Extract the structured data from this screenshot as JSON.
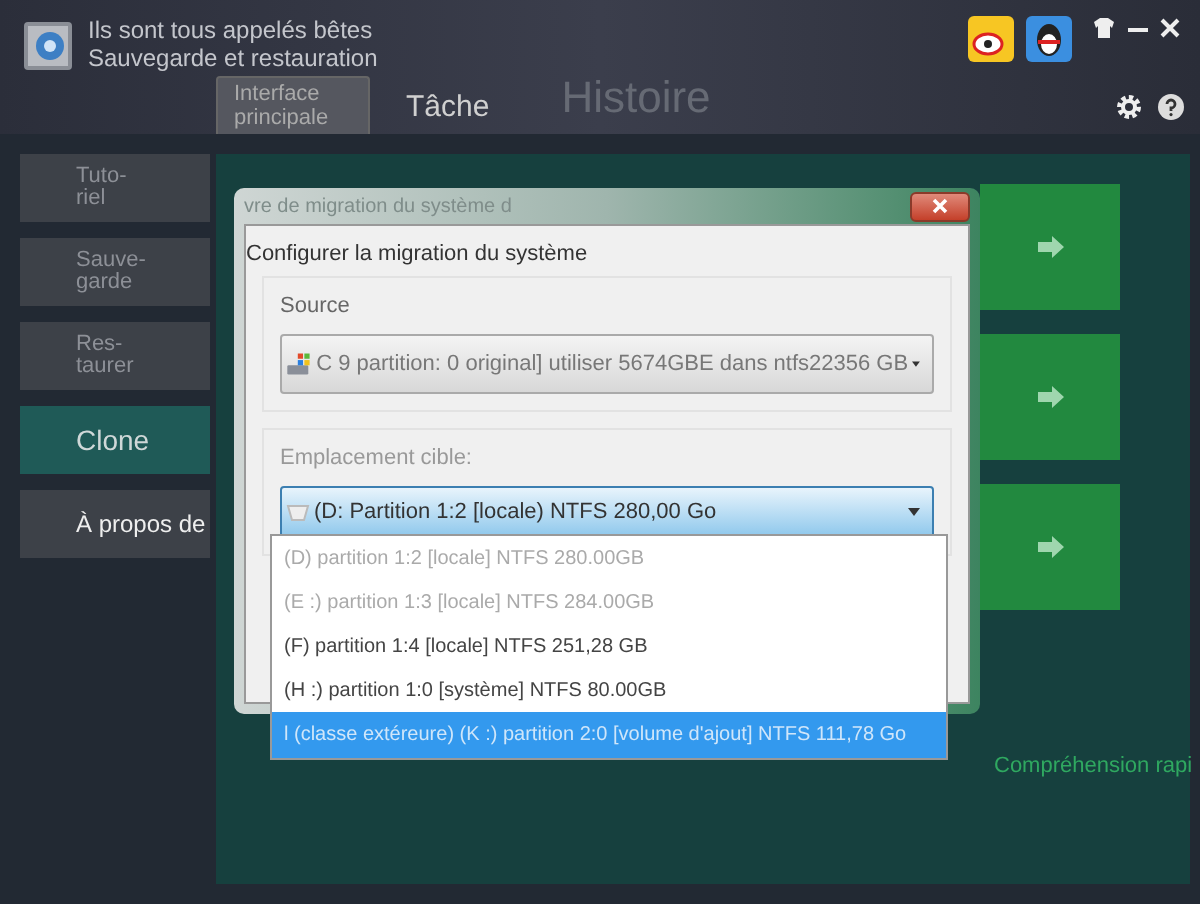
{
  "window": {
    "app_name": "Ils sont tous appelés bêtes",
    "subtitle": "Sauvegarde et restauration"
  },
  "tabs": [
    {
      "label": "Interface principale",
      "selected": true
    },
    {
      "label": "Tâche",
      "selected": false
    },
    {
      "label": "Histoire",
      "selected": false
    }
  ],
  "sidebar": {
    "items": [
      {
        "label": "Tuto-\nriel",
        "selected": false
      },
      {
        "label": "Sauve-\ngarde",
        "selected": false
      },
      {
        "label": "Res-\ntaurer",
        "selected": false
      },
      {
        "label": "Clone",
        "selected": true
      },
      {
        "label": "À propos de",
        "selected": false
      }
    ]
  },
  "dialog": {
    "title": "vre de migration du système d",
    "heading": "Configurer la migration du système",
    "source": {
      "label": "Source",
      "value": "C 9 partition: 0 original] utiliser 5674GBE dans ntfs22356 GB"
    },
    "target": {
      "label": "Emplacement cible:",
      "value": "(D: Partition 1:2 [locale) NTFS 280,00 Go",
      "expanded": true,
      "options": [
        {
          "label": "(D) partition 1:2 [locale] NTFS 280.00GB",
          "disabled": true,
          "selected": false
        },
        {
          "label": "(E :) partition 1:3 [locale] NTFS 284.00GB",
          "disabled": true,
          "selected": false
        },
        {
          "label": "(F) partition 1:4 [locale] NTFS 251,28 GB",
          "disabled": false,
          "selected": false
        },
        {
          "label": "(H :) partition 1:0 [système] NTFS 80.00GB",
          "disabled": false,
          "selected": false
        },
        {
          "label": "l (classe extéreure) (K :) partition 2:0 [volume d'ajout] NTFS 111,78 Go",
          "disabled": false,
          "selected": true
        }
      ]
    }
  },
  "footer_link": "Compréhension rapi"
}
